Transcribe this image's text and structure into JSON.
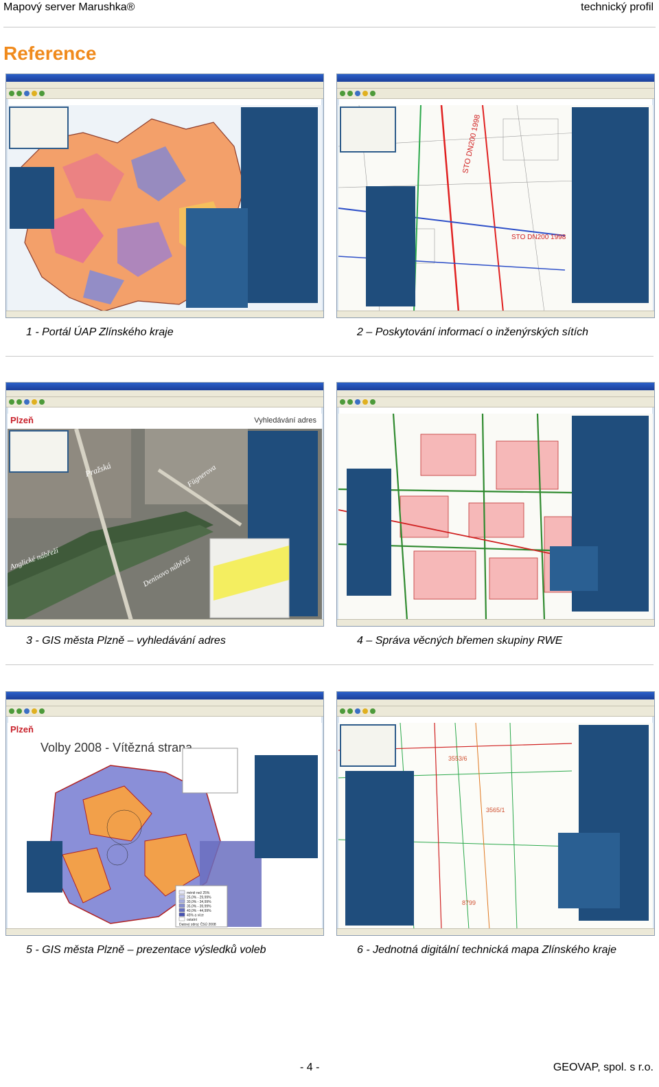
{
  "header": {
    "left": "Mapový server Marushka®",
    "right": "technický profil"
  },
  "page_title": "Reference",
  "screenshots": [
    {
      "caption": "1 - Portál ÚAP Zlínského kraje"
    },
    {
      "caption": "2 – Poskytování informací o inženýrských sítích",
      "map_label_1": "STO DN200 1998",
      "map_label_2": "STO DN200 1998"
    },
    {
      "caption": "3 - GIS města Plzně – vyhledávání adres",
      "app_logo": "Plzeň",
      "app_heading": "Vyhledávání adres",
      "street_1": "Pražská",
      "street_2": "Fügnerova",
      "street_3": "Anglické nábřeží",
      "street_4": "Denisovo nábřeží"
    },
    {
      "caption": "4 – Správa věcných břemen skupiny RWE"
    },
    {
      "caption": "5 - GIS města Plzně – prezentace výsledků voleb",
      "app_logo": "Plzeň",
      "map_title": "Volby 2008 - Vítězná strana",
      "legend_items": [
        "méně než 25%",
        "25,0% - 29,99%",
        "30,0% - 34,99%",
        "35,0% - 39,99%",
        "40,0% - 44,99%",
        "45% a více",
        "ostatní"
      ],
      "source": "Datový zdroj: ČSÚ 2008"
    },
    {
      "caption": "6 - Jednotná digitální technická mapa Zlínského kraje",
      "parcel_1": "3553/6",
      "parcel_2": "3565/1",
      "parcel_3": "8799"
    }
  ],
  "footer": {
    "page_number": "- 4 -",
    "company": "GEOVAP, spol. s r.o."
  }
}
